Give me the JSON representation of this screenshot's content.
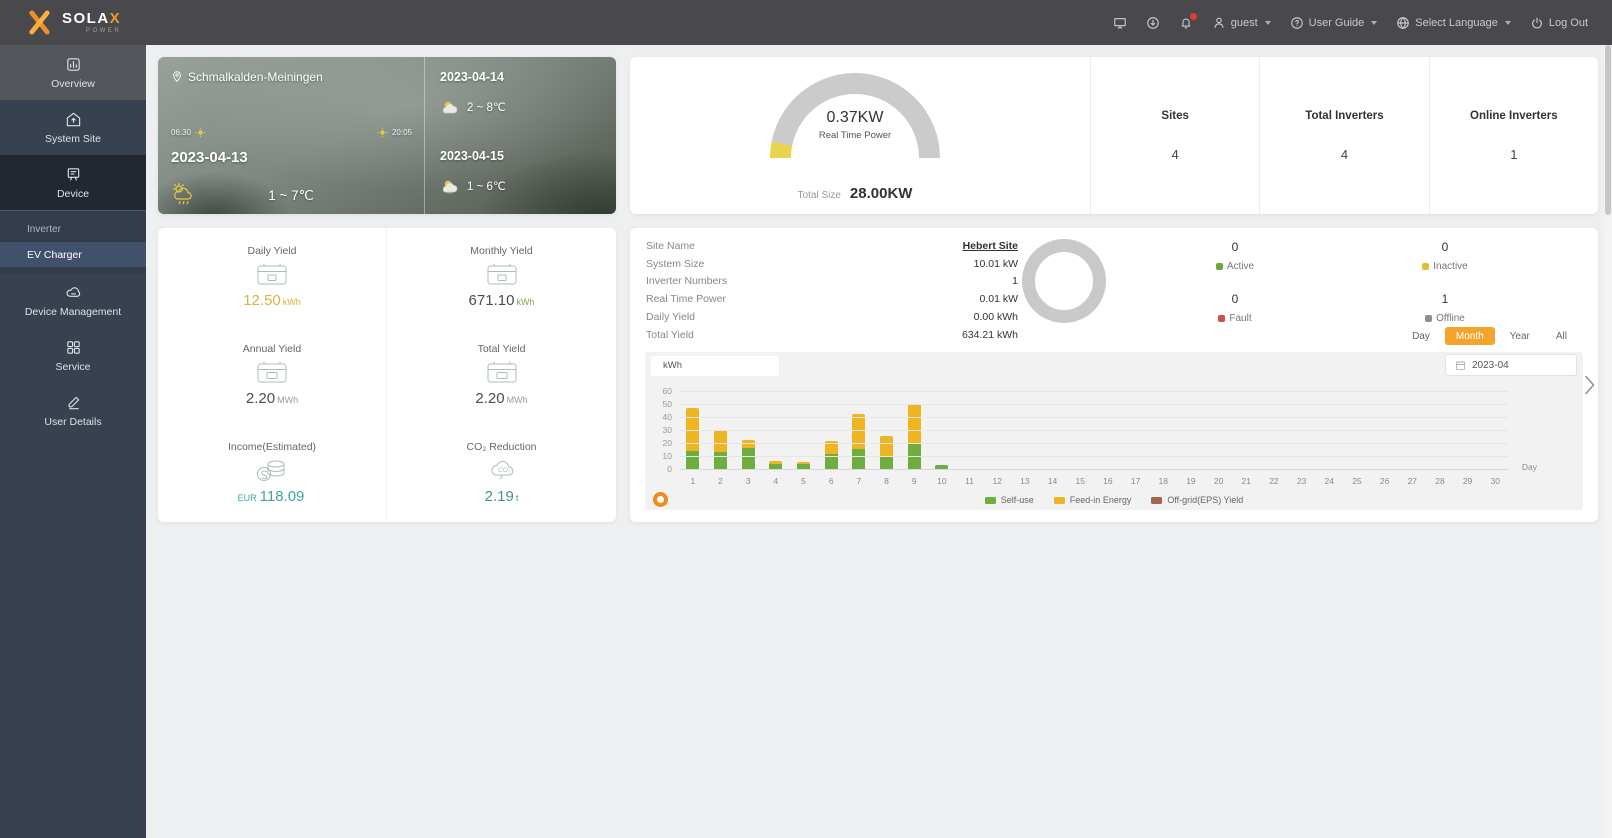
{
  "navbar": {
    "logo": {
      "primary": "SOLA",
      "accent": "X",
      "secondary": "POWER"
    },
    "menu": {
      "user": "guest",
      "user_guide": "User Guide",
      "language": "Select Language",
      "logout": "Log Out"
    }
  },
  "sidebar": {
    "items": [
      {
        "label": "Overview"
      },
      {
        "label": "System Site"
      },
      {
        "label": "Device"
      },
      {
        "label": "Device Management"
      },
      {
        "label": "Service"
      },
      {
        "label": "User Details"
      }
    ],
    "submenu": [
      {
        "label": "Inverter"
      },
      {
        "label": "EV Charger"
      }
    ]
  },
  "weather": {
    "location": "Schmalkalden-Meiningen",
    "sunrise": "06:30",
    "sunset": "20:05",
    "today": {
      "date": "2023-04-13",
      "temp": "1 ~ 7℃"
    },
    "forecast": [
      {
        "date": "2023-04-14",
        "temp": "2 ~ 8℃"
      },
      {
        "date": "2023-04-15",
        "temp": "1 ~ 6℃"
      }
    ]
  },
  "power_card": {
    "real_time_value": "0.37KW",
    "real_time_label": "Real Time Power",
    "total_size_label": "Total Size",
    "total_size_value": "28.00KW",
    "gauge_track_color": "#cbcbcb",
    "gauge_fill_color": "#e9d44e",
    "stats": [
      {
        "label": "Sites",
        "value": "4"
      },
      {
        "label": "Total Inverters",
        "value": "4"
      },
      {
        "label": "Online Inverters",
        "value": "1"
      }
    ]
  },
  "yield_card": {
    "cells": [
      {
        "label": "Daily Yield",
        "value": "12.50",
        "unit": "kWh",
        "color": "#d8b440",
        "unit_color": "#d8b440"
      },
      {
        "label": "Monthly Yield",
        "value": "671.10",
        "unit": "kWh",
        "color": "#4d4d4d",
        "unit_color": "#7aa84f"
      },
      {
        "label": "Annual Yield",
        "value": "2.20",
        "unit": "MWh",
        "color": "#4d4d4d",
        "unit_color": "#999999"
      },
      {
        "label": "Total Yield",
        "value": "2.20",
        "unit": "MWh",
        "color": "#4d4d4d",
        "unit_color": "#999999"
      },
      {
        "label": "Income(Estimated)",
        "prefix": "EUR",
        "value": "118.09",
        "unit": "",
        "color": "#3aa7a3",
        "unit_color": "#3aa7a3"
      },
      {
        "label": "CO₂ Reduction",
        "value": "2.19",
        "unit": "t",
        "color": "#4b8f96",
        "unit_color": "#4b8f96"
      }
    ]
  },
  "site_card": {
    "details": [
      {
        "label": "Site Name",
        "value": "Hebert Site"
      },
      {
        "label": "System Size",
        "value": "10.01 kW"
      },
      {
        "label": "Inverter Numbers",
        "value": "1"
      },
      {
        "label": "Real Time Power",
        "value": "0.01 kW"
      },
      {
        "label": "Daily Yield",
        "value": "0.00 kWh"
      },
      {
        "label": "Total Yield",
        "value": "634.21 kWh"
      }
    ],
    "statuses": [
      {
        "value": "0",
        "label": "Active",
        "color": "#63a93c"
      },
      {
        "value": "0",
        "label": "Inactive",
        "color": "#e5bd2e"
      },
      {
        "value": "0",
        "label": "Fault",
        "color": "#d34f44"
      },
      {
        "value": "1",
        "label": "Offline",
        "color": "#8f8f8f"
      }
    ],
    "periods": [
      "Day",
      "Month",
      "Year",
      "All"
    ],
    "active_period": "Month",
    "date_value": "2023-04",
    "unit_tab": "kWh"
  },
  "chart_data": {
    "type": "bar",
    "stacked": true,
    "x": [
      1,
      2,
      3,
      4,
      5,
      6,
      7,
      8,
      9,
      10,
      11,
      12,
      13,
      14,
      15,
      16,
      17,
      18,
      19,
      20,
      21,
      22,
      23,
      24,
      25,
      26,
      27,
      28,
      29,
      30
    ],
    "xlabel": "Day",
    "ylabel": "kWh",
    "ylim": [
      0,
      60
    ],
    "yticks": [
      0,
      10,
      20,
      30,
      40,
      50,
      60
    ],
    "grid": true,
    "legend_position": "bottom",
    "series": [
      {
        "name": "Self-use",
        "color": "#6fae3e",
        "values": [
          15,
          14,
          17,
          5,
          5,
          12,
          16,
          11,
          21,
          4,
          0,
          0,
          0,
          0,
          0,
          0,
          0,
          0,
          0,
          0,
          0,
          0,
          0,
          0,
          0,
          0,
          0,
          0,
          0,
          0
        ]
      },
      {
        "name": "Feed-in Energy",
        "color": "#eeb421",
        "values": [
          33,
          17,
          6,
          2,
          1,
          10,
          27,
          15,
          30,
          0,
          0,
          0,
          0,
          0,
          0,
          0,
          0,
          0,
          0,
          0,
          0,
          0,
          0,
          0,
          0,
          0,
          0,
          0,
          0,
          0
        ]
      },
      {
        "name": "Off-grid(EPS) Yield",
        "color": "#a7644d",
        "values": [
          0,
          0,
          0,
          0,
          0,
          0,
          0,
          0,
          0,
          0,
          0,
          0,
          0,
          0,
          0,
          0,
          0,
          0,
          0,
          0,
          0,
          0,
          0,
          0,
          0,
          0,
          0,
          0,
          0,
          0
        ]
      }
    ]
  },
  "icons": {
    "logo-x-icon": "orange X strokes",
    "monitor-icon": "screen outline",
    "download-icon": "circle with down arrow",
    "alarm-icon": "bell with red badge",
    "user-icon": "person silhouette",
    "help-icon": "question circle",
    "globe-icon": "globe",
    "power-icon": "power symbol",
    "location-pin-icon": "map pin",
    "sun-icon": "yellow sun",
    "weather-rain-icon": "sun cloud rain outline",
    "weather-cloud-sun-icon": "sun behind cloud",
    "yield-meter-icon": "device box outline",
    "coins-icon": "coin stack",
    "co2-icon": "CO₂ cloud",
    "calendar-icon": "calendar",
    "chevron-right-icon": "next arrow"
  }
}
